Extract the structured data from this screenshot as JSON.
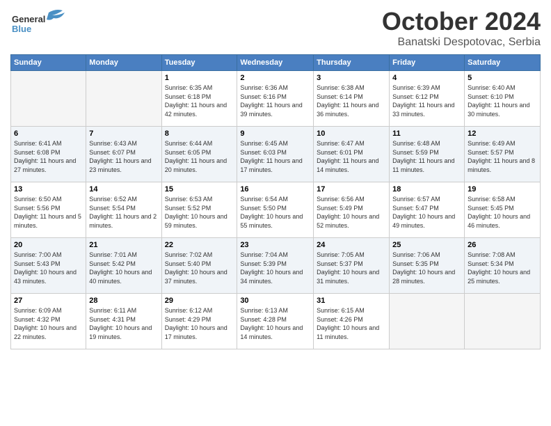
{
  "header": {
    "logo_general": "General",
    "logo_blue": "Blue",
    "month_title": "October 2024",
    "location": "Banatski Despotovac, Serbia"
  },
  "weekdays": [
    "Sunday",
    "Monday",
    "Tuesday",
    "Wednesday",
    "Thursday",
    "Friday",
    "Saturday"
  ],
  "weeks": [
    [
      {
        "day": "",
        "info": ""
      },
      {
        "day": "",
        "info": ""
      },
      {
        "day": "1",
        "info": "Sunrise: 6:35 AM\nSunset: 6:18 PM\nDaylight: 11 hours and 42 minutes."
      },
      {
        "day": "2",
        "info": "Sunrise: 6:36 AM\nSunset: 6:16 PM\nDaylight: 11 hours and 39 minutes."
      },
      {
        "day": "3",
        "info": "Sunrise: 6:38 AM\nSunset: 6:14 PM\nDaylight: 11 hours and 36 minutes."
      },
      {
        "day": "4",
        "info": "Sunrise: 6:39 AM\nSunset: 6:12 PM\nDaylight: 11 hours and 33 minutes."
      },
      {
        "day": "5",
        "info": "Sunrise: 6:40 AM\nSunset: 6:10 PM\nDaylight: 11 hours and 30 minutes."
      }
    ],
    [
      {
        "day": "6",
        "info": "Sunrise: 6:41 AM\nSunset: 6:08 PM\nDaylight: 11 hours and 27 minutes."
      },
      {
        "day": "7",
        "info": "Sunrise: 6:43 AM\nSunset: 6:07 PM\nDaylight: 11 hours and 23 minutes."
      },
      {
        "day": "8",
        "info": "Sunrise: 6:44 AM\nSunset: 6:05 PM\nDaylight: 11 hours and 20 minutes."
      },
      {
        "day": "9",
        "info": "Sunrise: 6:45 AM\nSunset: 6:03 PM\nDaylight: 11 hours and 17 minutes."
      },
      {
        "day": "10",
        "info": "Sunrise: 6:47 AM\nSunset: 6:01 PM\nDaylight: 11 hours and 14 minutes."
      },
      {
        "day": "11",
        "info": "Sunrise: 6:48 AM\nSunset: 5:59 PM\nDaylight: 11 hours and 11 minutes."
      },
      {
        "day": "12",
        "info": "Sunrise: 6:49 AM\nSunset: 5:57 PM\nDaylight: 11 hours and 8 minutes."
      }
    ],
    [
      {
        "day": "13",
        "info": "Sunrise: 6:50 AM\nSunset: 5:56 PM\nDaylight: 11 hours and 5 minutes."
      },
      {
        "day": "14",
        "info": "Sunrise: 6:52 AM\nSunset: 5:54 PM\nDaylight: 11 hours and 2 minutes."
      },
      {
        "day": "15",
        "info": "Sunrise: 6:53 AM\nSunset: 5:52 PM\nDaylight: 10 hours and 59 minutes."
      },
      {
        "day": "16",
        "info": "Sunrise: 6:54 AM\nSunset: 5:50 PM\nDaylight: 10 hours and 55 minutes."
      },
      {
        "day": "17",
        "info": "Sunrise: 6:56 AM\nSunset: 5:49 PM\nDaylight: 10 hours and 52 minutes."
      },
      {
        "day": "18",
        "info": "Sunrise: 6:57 AM\nSunset: 5:47 PM\nDaylight: 10 hours and 49 minutes."
      },
      {
        "day": "19",
        "info": "Sunrise: 6:58 AM\nSunset: 5:45 PM\nDaylight: 10 hours and 46 minutes."
      }
    ],
    [
      {
        "day": "20",
        "info": "Sunrise: 7:00 AM\nSunset: 5:43 PM\nDaylight: 10 hours and 43 minutes."
      },
      {
        "day": "21",
        "info": "Sunrise: 7:01 AM\nSunset: 5:42 PM\nDaylight: 10 hours and 40 minutes."
      },
      {
        "day": "22",
        "info": "Sunrise: 7:02 AM\nSunset: 5:40 PM\nDaylight: 10 hours and 37 minutes."
      },
      {
        "day": "23",
        "info": "Sunrise: 7:04 AM\nSunset: 5:39 PM\nDaylight: 10 hours and 34 minutes."
      },
      {
        "day": "24",
        "info": "Sunrise: 7:05 AM\nSunset: 5:37 PM\nDaylight: 10 hours and 31 minutes."
      },
      {
        "day": "25",
        "info": "Sunrise: 7:06 AM\nSunset: 5:35 PM\nDaylight: 10 hours and 28 minutes."
      },
      {
        "day": "26",
        "info": "Sunrise: 7:08 AM\nSunset: 5:34 PM\nDaylight: 10 hours and 25 minutes."
      }
    ],
    [
      {
        "day": "27",
        "info": "Sunrise: 6:09 AM\nSunset: 4:32 PM\nDaylight: 10 hours and 22 minutes."
      },
      {
        "day": "28",
        "info": "Sunrise: 6:11 AM\nSunset: 4:31 PM\nDaylight: 10 hours and 19 minutes."
      },
      {
        "day": "29",
        "info": "Sunrise: 6:12 AM\nSunset: 4:29 PM\nDaylight: 10 hours and 17 minutes."
      },
      {
        "day": "30",
        "info": "Sunrise: 6:13 AM\nSunset: 4:28 PM\nDaylight: 10 hours and 14 minutes."
      },
      {
        "day": "31",
        "info": "Sunrise: 6:15 AM\nSunset: 4:26 PM\nDaylight: 10 hours and 11 minutes."
      },
      {
        "day": "",
        "info": ""
      },
      {
        "day": "",
        "info": ""
      }
    ]
  ]
}
